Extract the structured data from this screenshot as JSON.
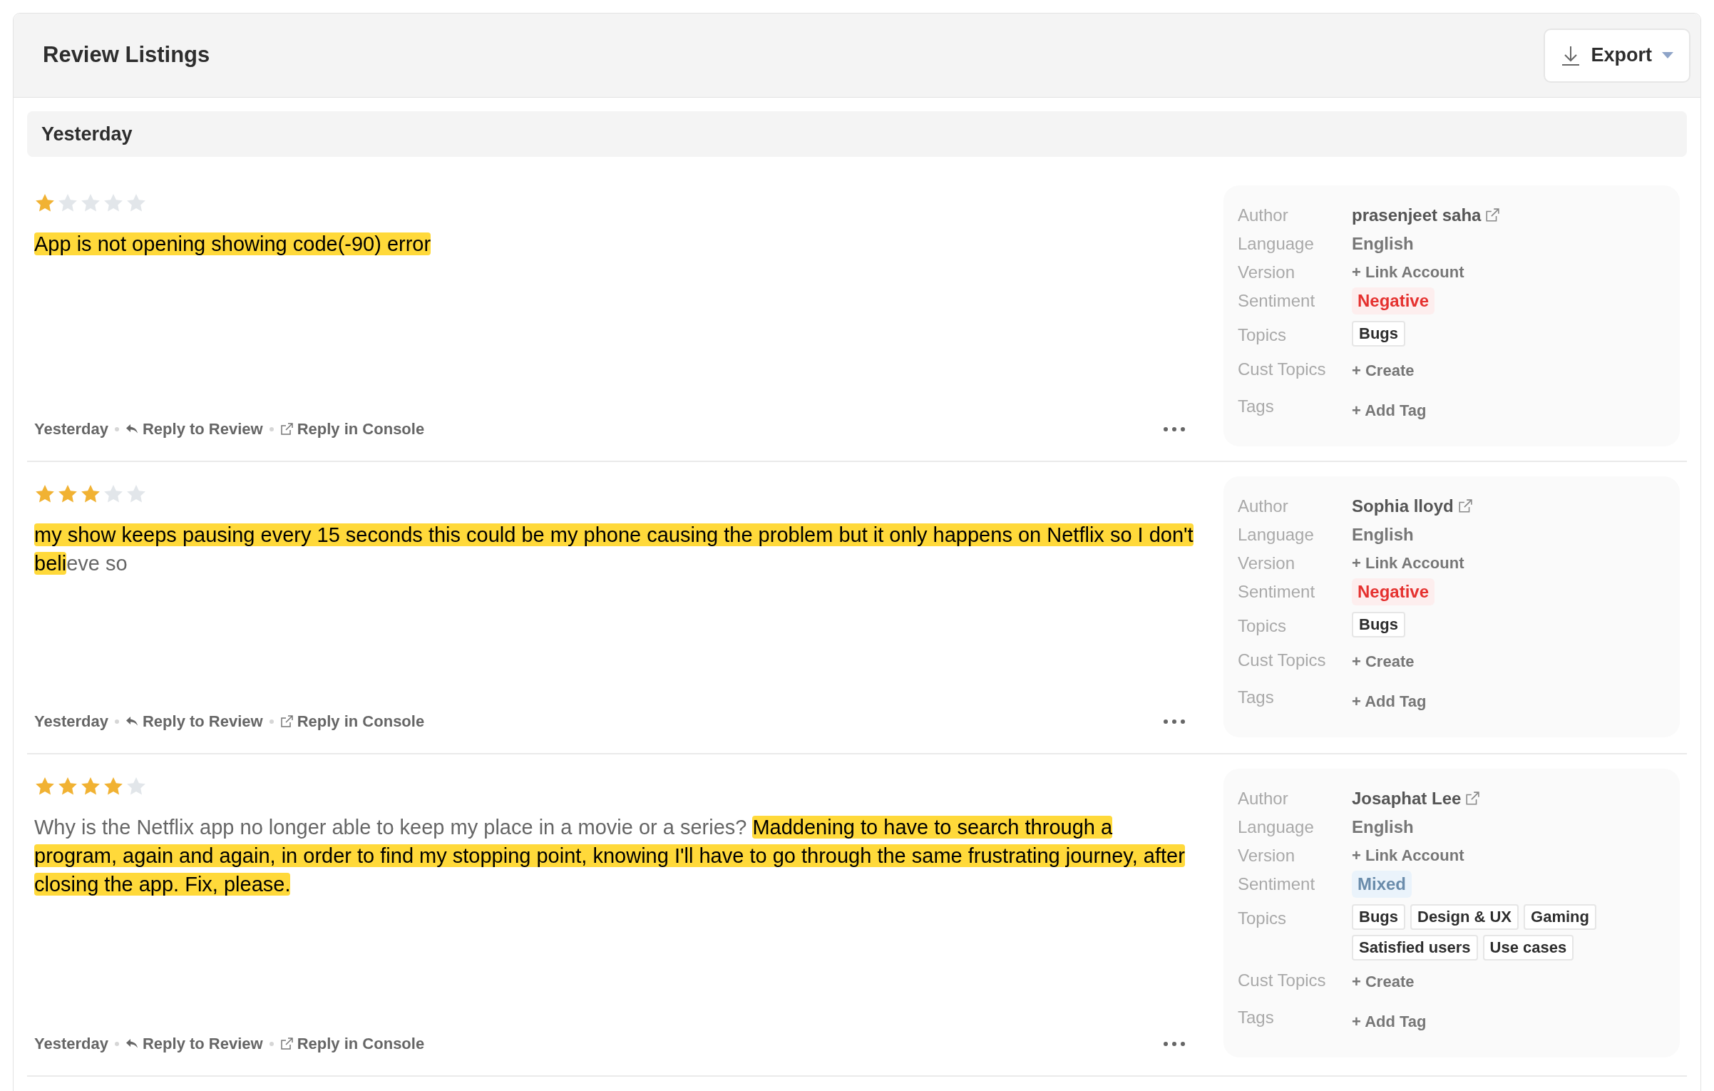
{
  "header": {
    "title": "Review Listings",
    "export_button": "Export"
  },
  "group": {
    "label": "Yesterday"
  },
  "reviews": [
    {
      "stars": 1,
      "segments": [
        {
          "text": "App is not opening showing code(-90) error",
          "highlighted": true
        }
      ],
      "date": "Yesterday",
      "reply_review": "Reply to Review",
      "reply_console": "Reply in Console",
      "details": {
        "author_label": "Author",
        "author": "prasenjeet saha",
        "language_label": "Language",
        "language": "English",
        "version_label": "Version",
        "version": "+ Link Account",
        "sentiment_label": "Sentiment",
        "sentiment": {
          "text": "Negative",
          "kind": "negative"
        },
        "topics_label": "Topics",
        "topics": [
          "Bugs"
        ],
        "cust_topics_label": "Cust Topics",
        "cust_topics": "+ Create",
        "tags_label": "Tags",
        "tags": "+ Add Tag"
      }
    },
    {
      "stars": 3,
      "segments": [
        {
          "text": "my show keeps pausing every 15 seconds this could be my phone causing the problem but it only happens on Netflix so I don't beli",
          "highlighted": true
        },
        {
          "text": "eve so",
          "highlighted": false
        }
      ],
      "date": "Yesterday",
      "reply_review": "Reply to Review",
      "reply_console": "Reply in Console",
      "details": {
        "author_label": "Author",
        "author": "Sophia lloyd",
        "language_label": "Language",
        "language": "English",
        "version_label": "Version",
        "version": "+ Link Account",
        "sentiment_label": "Sentiment",
        "sentiment": {
          "text": "Negative",
          "kind": "negative"
        },
        "topics_label": "Topics",
        "topics": [
          "Bugs"
        ],
        "cust_topics_label": "Cust Topics",
        "cust_topics": "+ Create",
        "tags_label": "Tags",
        "tags": "+ Add Tag"
      }
    },
    {
      "stars": 4,
      "segments": [
        {
          "text": "Why is the Netflix app no longer able to keep my place in a movie or a series? ",
          "highlighted": false
        },
        {
          "text": "Maddening to have to search through a program, again and again, in order to find my stopping point, knowing I'll have to go through the same frustrating journey, after closing the app. Fix, please.",
          "highlighted": true
        }
      ],
      "date": "Yesterday",
      "reply_review": "Reply to Review",
      "reply_console": "Reply in Console",
      "details": {
        "author_label": "Author",
        "author": "Josaphat Lee",
        "language_label": "Language",
        "language": "English",
        "version_label": "Version",
        "version": "+ Link Account",
        "sentiment_label": "Sentiment",
        "sentiment": {
          "text": "Mixed",
          "kind": "mixed"
        },
        "topics_label": "Topics",
        "topics": [
          "Bugs",
          "Design & UX",
          "Gaming",
          "Satisfied users",
          "Use cases"
        ],
        "cust_topics_label": "Cust Topics",
        "cust_topics": "+ Create",
        "tags_label": "Tags",
        "tags": "+ Add Tag"
      }
    }
  ]
}
